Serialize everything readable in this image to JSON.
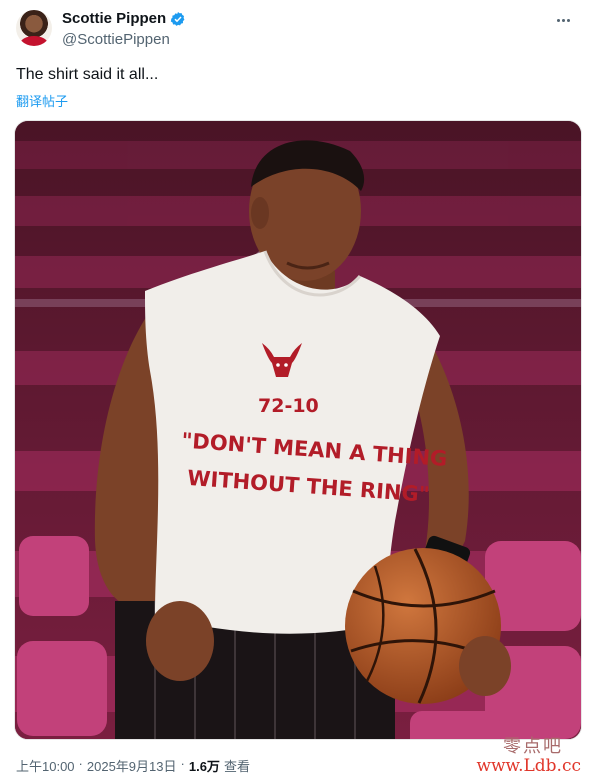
{
  "post": {
    "display_name": "Scottie Pippen",
    "handle": "@ScottiePippen",
    "text": "The shirt said it all...",
    "translate_label": "翻译帖子",
    "footer": {
      "time": "上午10:00",
      "sep1": "·",
      "date": "2025年9月13日",
      "sep2": "·",
      "views": "1.6万",
      "views_label": "查看"
    }
  },
  "shirt": {
    "record": "72-10",
    "line1": "\"DON'T MEAN A THING",
    "line2": "WITHOUT THE RING\""
  },
  "watermark": {
    "cn": "零点吧",
    "url": "www.Ldb.cc"
  },
  "icons": {
    "verified": "verified-badge-icon",
    "more": "more-horizontal-icon",
    "bull": "bulls-logo-icon"
  },
  "colors": {
    "accent": "#1d9bf0",
    "seat": "#b8346a",
    "shirt_text": "#b21c28",
    "watermark_url": "#e0362a"
  }
}
